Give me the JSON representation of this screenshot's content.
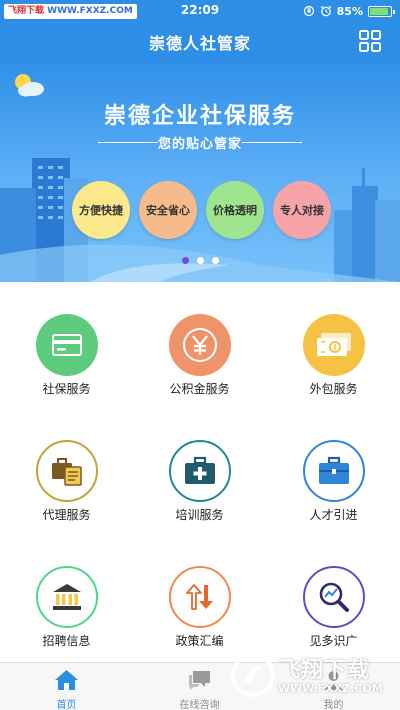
{
  "status_bar": {
    "watermark_part1": "飞翔下载",
    "watermark_part2": "WWW.FXXZ.COM",
    "time": "22:09",
    "battery": "85%"
  },
  "header": {
    "title": "崇德人社管家",
    "menu_icon": "grid-icon"
  },
  "banner": {
    "title": "崇德企业社保服务",
    "subtitle": "您的贴心管家",
    "features": [
      {
        "label": "方便快捷",
        "color": "#fbe98c"
      },
      {
        "label": "安全省心",
        "color": "#f6bb8a"
      },
      {
        "label": "价格透明",
        "color": "#9ee58d"
      },
      {
        "label": "专人对接",
        "color": "#f7a4a9"
      }
    ],
    "carousel_active_index": 0,
    "carousel_count": 3
  },
  "services": [
    {
      "label": "社保服务",
      "icon": "card-icon",
      "style": "filled",
      "color": "#5ccb7e"
    },
    {
      "label": "公积金服务",
      "icon": "yen-icon",
      "style": "filled",
      "color": "#ef946a"
    },
    {
      "label": "外包服务",
      "icon": "cash-icon",
      "style": "filled",
      "color": "#f5c243"
    },
    {
      "label": "代理服务",
      "icon": "briefcase-docs-icon",
      "style": "ring",
      "color": "#c2a437"
    },
    {
      "label": "培训服务",
      "icon": "medical-kit-icon",
      "style": "ring",
      "color": "#1f8a8e"
    },
    {
      "label": "人才引进",
      "icon": "briefcase-icon",
      "style": "ring",
      "color": "#2f86d6"
    },
    {
      "label": "招聘信息",
      "icon": "bank-icon",
      "style": "ring",
      "color": "#4fd68a"
    },
    {
      "label": "政策汇编",
      "icon": "up-down-arrows-icon",
      "style": "ring",
      "color": "#f08a4f"
    },
    {
      "label": "见多识广",
      "icon": "magnifier-chart-icon",
      "style": "ring",
      "color": "#5b4fc4"
    }
  ],
  "tabs": [
    {
      "label": "首页",
      "icon": "home-icon",
      "active": true
    },
    {
      "label": "在线咨询",
      "icon": "chat-icon",
      "active": false
    },
    {
      "label": "我的",
      "icon": "user-icon",
      "active": false
    }
  ],
  "watermark_bottom": {
    "title": "飞翔下载",
    "url": "WWW.FXXZ.COM"
  },
  "colors": {
    "primary": "#2d8ee6",
    "carousel_active": "#7b49d3"
  }
}
